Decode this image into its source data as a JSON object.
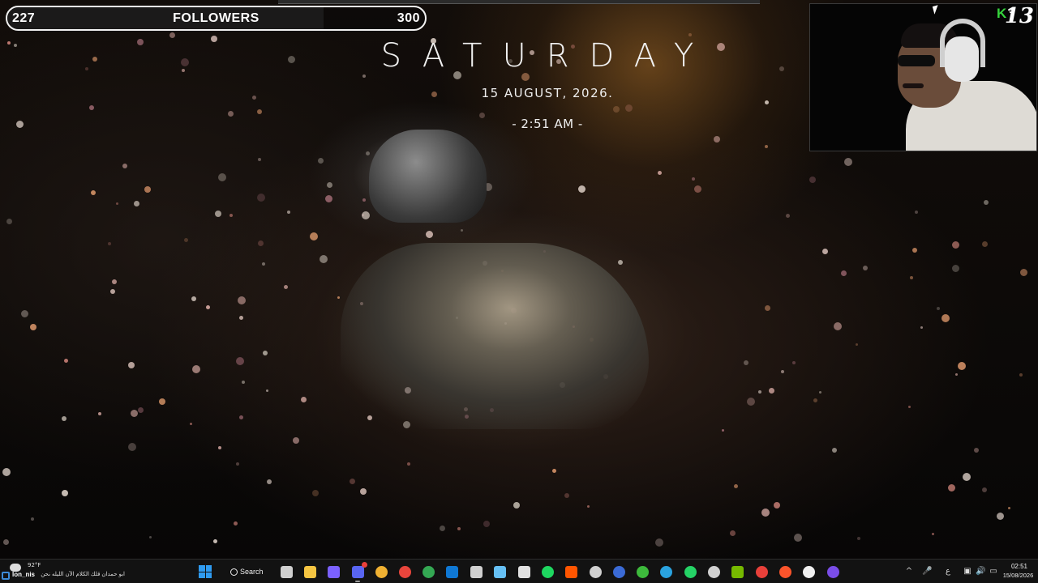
{
  "follower_goal": {
    "current": "227",
    "label": "FOLLOWERS",
    "goal": "300",
    "progress_fraction": 0.757
  },
  "clock_widget": {
    "day": "SATURDAY",
    "date": "15 AUGUST, 2026.",
    "time": "- 2:51 AM -"
  },
  "webcam": {
    "badge_number": "13",
    "badge_logo": "K",
    "logo_color": "#35d43c"
  },
  "taskbar": {
    "weather": {
      "temperature": "92°F",
      "icon": "partly-cloudy-icon"
    },
    "news": {
      "user": "lon_nis",
      "text": "ابو حمدان قلك الكلام الآن الليله نحن"
    },
    "search": {
      "label": "Search",
      "icon": "search-icon"
    },
    "apps": [
      {
        "name": "start",
        "icon": "windows-logo-icon",
        "color": "#2f9bf0"
      },
      {
        "name": "task-view",
        "icon": "task-view-icon",
        "color": "#cfcfcf"
      },
      {
        "name": "file-explorer",
        "icon": "folder-icon",
        "color": "#f5c542"
      },
      {
        "name": "copilot",
        "icon": "copilot-icon",
        "color": "#7b61ff"
      },
      {
        "name": "discord",
        "icon": "discord-icon",
        "color": "#5865f2",
        "badge": true
      },
      {
        "name": "discord-ptb",
        "icon": "discord-ptb-icon",
        "color": "#f0b132"
      },
      {
        "name": "chrome",
        "icon": "chrome-icon",
        "color": "#e8453c"
      },
      {
        "name": "chrome-alt",
        "icon": "chrome-icon",
        "color": "#34a853"
      },
      {
        "name": "outlook",
        "icon": "outlook-icon",
        "color": "#0f78d4"
      },
      {
        "name": "obs",
        "icon": "obs-icon",
        "color": "#d0d0d0"
      },
      {
        "name": "steam",
        "icon": "steam-icon",
        "color": "#66c0f4"
      },
      {
        "name": "epic-games",
        "icon": "epic-games-icon",
        "color": "#e0e0e0"
      },
      {
        "name": "spotify",
        "icon": "spotify-icon",
        "color": "#1ed760"
      },
      {
        "name": "faceit",
        "icon": "faceit-icon",
        "color": "#ff5500"
      },
      {
        "name": "github-desktop",
        "icon": "github-icon",
        "color": "#d0d0d0"
      },
      {
        "name": "ea",
        "icon": "ea-icon",
        "color": "#3b6bd6"
      },
      {
        "name": "xbox",
        "icon": "xbox-icon",
        "color": "#3dba3c"
      },
      {
        "name": "telegram",
        "icon": "telegram-icon",
        "color": "#2aa3e0"
      },
      {
        "name": "whatsapp",
        "icon": "whatsapp-icon",
        "color": "#25d366"
      },
      {
        "name": "settings-app",
        "icon": "gear-icon",
        "color": "#d0d0d0"
      },
      {
        "name": "nvidia",
        "icon": "nvidia-icon",
        "color": "#76b900"
      },
      {
        "name": "riot-client",
        "icon": "riot-icon",
        "color": "#e8403a"
      },
      {
        "name": "brave",
        "icon": "brave-icon",
        "color": "#fb542b"
      },
      {
        "name": "steelseries",
        "icon": "steelseries-icon",
        "color": "#f0f0f0"
      },
      {
        "name": "obs-studio",
        "icon": "record-icon",
        "color": "#7a4de8"
      }
    ],
    "tray": {
      "chevron": "^",
      "language": "ع",
      "time": "02:51",
      "date": "15/08/2026"
    }
  }
}
